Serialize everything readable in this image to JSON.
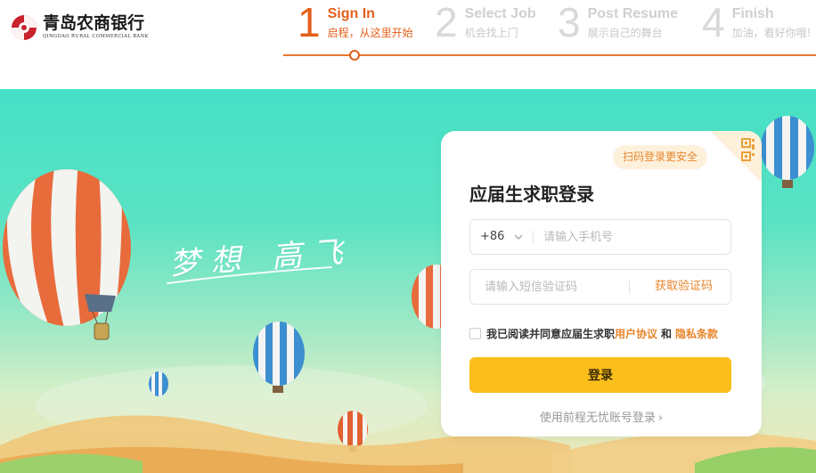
{
  "brand": {
    "name_cn": "青岛农商银行",
    "name_en": "QINGDAO RURAL COMMERCIAL BANK",
    "colors": {
      "logo_red": "#c8232c"
    }
  },
  "steps": [
    {
      "num": "1",
      "title": "Sign In",
      "subtitle": "启程，从这里开始",
      "active": true
    },
    {
      "num": "2",
      "title": "Select Job",
      "subtitle": "机会找上门",
      "active": false
    },
    {
      "num": "3",
      "title": "Post Resume",
      "subtitle": "展示自己的舞台",
      "active": false
    },
    {
      "num": "4",
      "title": "Finish",
      "subtitle": "加油，看好你哦!",
      "active": false
    }
  ],
  "progress": {
    "current_step": 1,
    "total_steps": 4,
    "accent": "#e35f1a"
  },
  "banner": {
    "slogan": "梦想 高飞",
    "colors": {
      "sky_top": "#45e0c6",
      "sky_bottom": "#efe6b6"
    }
  },
  "login": {
    "qr_tip": "扫码登录更安全",
    "title": "应届生求职登录",
    "country_code": "+86",
    "phone_placeholder": "请输入手机号",
    "code_placeholder": "请输入短信验证码",
    "get_code_label": "获取验证码",
    "agree_prefix": "我已阅读并同意应届生求职",
    "user_agreement": "用户协议",
    "and": "和",
    "privacy_policy": "隐私条款",
    "login_button": "登录",
    "alt_login": "使用前程无忧账号登录",
    "alt_login_arrow": "›",
    "colors": {
      "button": "#fbbf1b",
      "link": "#e8862d"
    }
  }
}
